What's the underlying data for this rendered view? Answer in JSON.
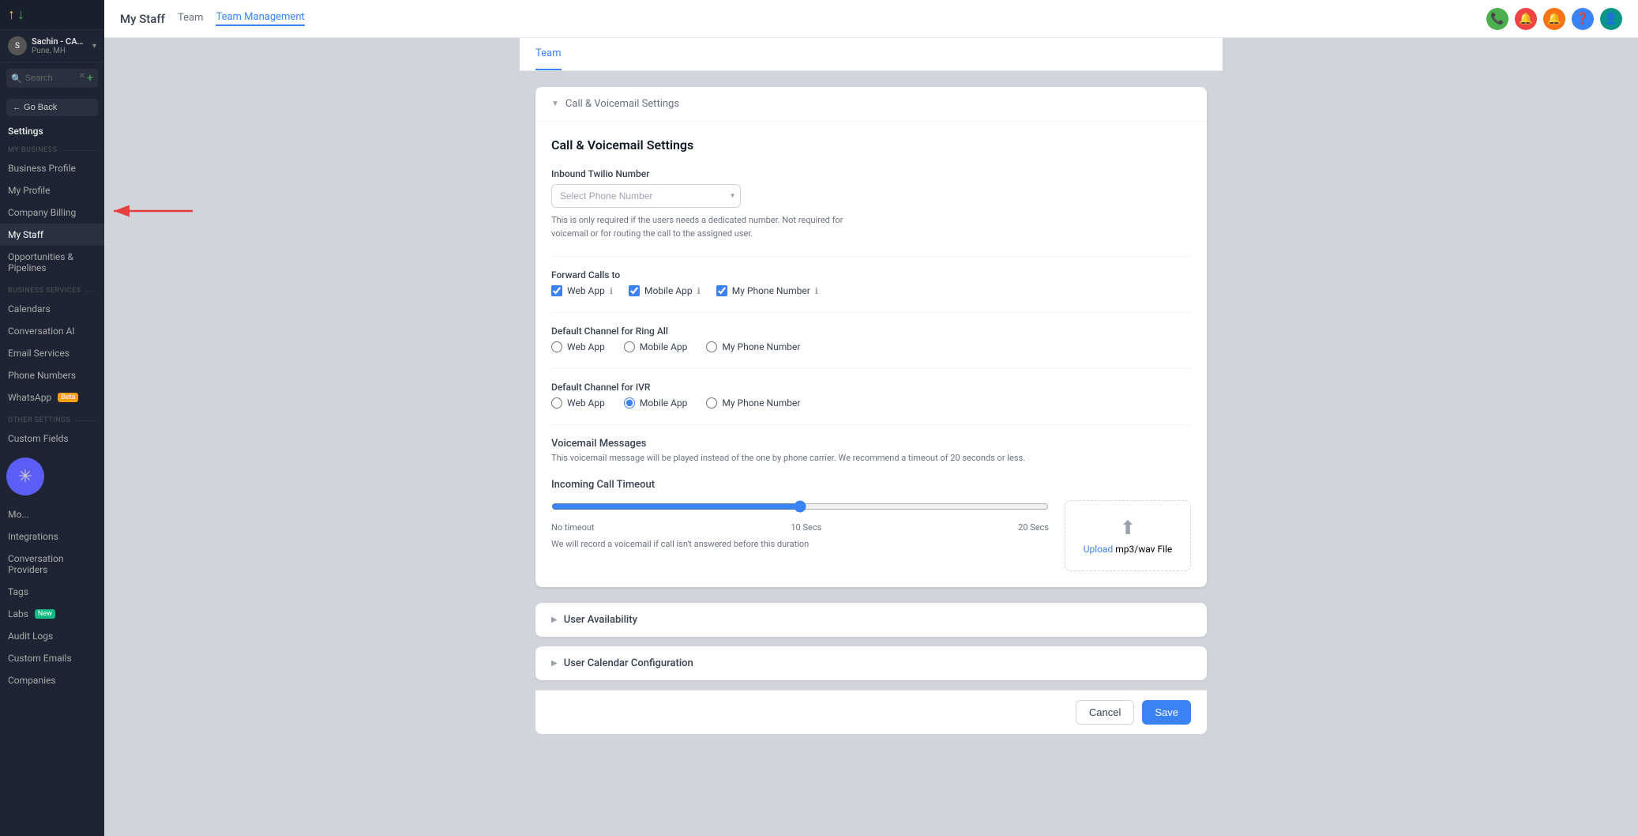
{
  "app": {
    "logo_arrow_up": "↑",
    "logo_arrow_down": "↓"
  },
  "user": {
    "name": "Sachin - CAFE PETER",
    "location": "Pune, MH",
    "avatar_initial": "S"
  },
  "search": {
    "placeholder": "Search"
  },
  "go_back": "← Go Back",
  "settings_title": "Settings",
  "sidebar": {
    "my_business_label": "MY BUSINESS",
    "business_services_label": "BUSINESS SERVICES",
    "other_settings_label": "OTHER SETTINGS",
    "items": [
      {
        "id": "business-profile",
        "label": "Business Profile"
      },
      {
        "id": "my-profile",
        "label": "My Profile"
      },
      {
        "id": "company-billing",
        "label": "Company Billing"
      },
      {
        "id": "my-staff",
        "label": "My Staff",
        "active": true
      },
      {
        "id": "opportunities-pipelines",
        "label": "Opportunities & Pipelines"
      },
      {
        "id": "calendars",
        "label": "Calendars"
      },
      {
        "id": "conversation-ai",
        "label": "Conversation AI"
      },
      {
        "id": "email-services",
        "label": "Email Services"
      },
      {
        "id": "phone-numbers",
        "label": "Phone Numbers"
      },
      {
        "id": "whatsapp",
        "label": "WhatsApp",
        "badge": "Beta"
      },
      {
        "id": "custom-fields",
        "label": "Custom Fields"
      },
      {
        "id": "more",
        "label": "Mo..."
      },
      {
        "id": "integrations",
        "label": "Integrations"
      },
      {
        "id": "conversation-providers",
        "label": "Conversation Providers"
      },
      {
        "id": "tags",
        "label": "Tags"
      },
      {
        "id": "labs",
        "label": "Labs",
        "badge": "New"
      },
      {
        "id": "audit-logs",
        "label": "Audit Logs"
      },
      {
        "id": "custom-emails",
        "label": "Custom Emails"
      },
      {
        "id": "companies",
        "label": "Companies"
      }
    ]
  },
  "top_bar": {
    "page_title": "My Staff",
    "nav_items": [
      {
        "id": "team-nav",
        "label": "Team",
        "active": false
      },
      {
        "id": "team-management-nav",
        "label": "Team Management",
        "active": true
      }
    ]
  },
  "inner_tabs": [
    {
      "id": "team-tab",
      "label": "Team",
      "active": true
    }
  ],
  "call_voicemail": {
    "section_nav_label": "Call & Voicemail Settings",
    "section_title": "Call & Voicemail Settings",
    "inbound_twilio_label": "Inbound Twilio Number",
    "select_placeholder": "Select Phone Number",
    "helper_text": "This is only required if the users needs a dedicated number. Not required for voicemail or for routing the call to the assigned user.",
    "forward_calls_label": "Forward Calls to",
    "forward_options": [
      {
        "id": "web-app",
        "label": "Web App",
        "checked": true
      },
      {
        "id": "mobile-app",
        "label": "Mobile App",
        "checked": true
      },
      {
        "id": "my-phone-number",
        "label": "My Phone Number",
        "checked": true
      }
    ],
    "default_ring_all_label": "Default Channel for Ring All",
    "ring_all_options": [
      {
        "id": "ring-web-app",
        "label": "Web App",
        "selected": false
      },
      {
        "id": "ring-mobile-app",
        "label": "Mobile App",
        "selected": false
      },
      {
        "id": "ring-my-phone",
        "label": "My Phone Number",
        "selected": false
      }
    ],
    "default_ivr_label": "Default Channel for IVR",
    "ivr_options": [
      {
        "id": "ivr-web-app",
        "label": "Web App",
        "selected": false
      },
      {
        "id": "ivr-mobile-app",
        "label": "Mobile App",
        "selected": true
      },
      {
        "id": "ivr-my-phone",
        "label": "My Phone Number",
        "selected": false
      }
    ],
    "voicemail_title": "Voicemail Messages",
    "voicemail_desc": "This voicemail message will be played instead of the one by phone carrier. We recommend a timeout of 20 seconds or less.",
    "incoming_timeout_label": "Incoming Call Timeout",
    "slider_labels": [
      "No timeout",
      "10 Secs",
      "20 Secs"
    ],
    "slider_value": 30,
    "upload_text": "Upload",
    "upload_subtext": "mp3/wav File",
    "timeout_note": "We will record a voicemail if call isn't answered before this duration"
  },
  "collapsible": {
    "user_availability": "User Availability",
    "user_calendar": "User Calendar Configuration"
  },
  "footer": {
    "cancel_label": "Cancel",
    "save_label": "Save"
  },
  "top_icons": [
    "📞",
    "🔔",
    "🔔",
    "❓",
    "👤"
  ]
}
